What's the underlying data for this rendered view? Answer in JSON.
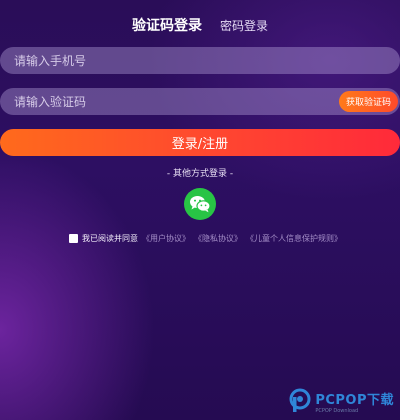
{
  "tabs": {
    "active_label": "验证码登录",
    "password_label": "密码登录"
  },
  "phone": {
    "placeholder": "请输入手机号"
  },
  "code": {
    "placeholder": "请输入验证码",
    "get_code_label": "获取验证码"
  },
  "submit": {
    "label": "登录/注册"
  },
  "other_login": {
    "label": "-  其他方式登录  -",
    "icon": "wechat-icon"
  },
  "agreement": {
    "prefix": "我已阅读并同意",
    "links": [
      "《用户协议》",
      "《隐私协议》",
      "《儿童个人信息保护规则》"
    ]
  },
  "watermark": {
    "main": "PCPOP下载",
    "sub": "PCPOP Download"
  },
  "colors": {
    "accent_start": "#ff6a1c",
    "accent_end": "#ff2a3a",
    "wechat": "#28c445",
    "background": "#2c0e5e"
  }
}
